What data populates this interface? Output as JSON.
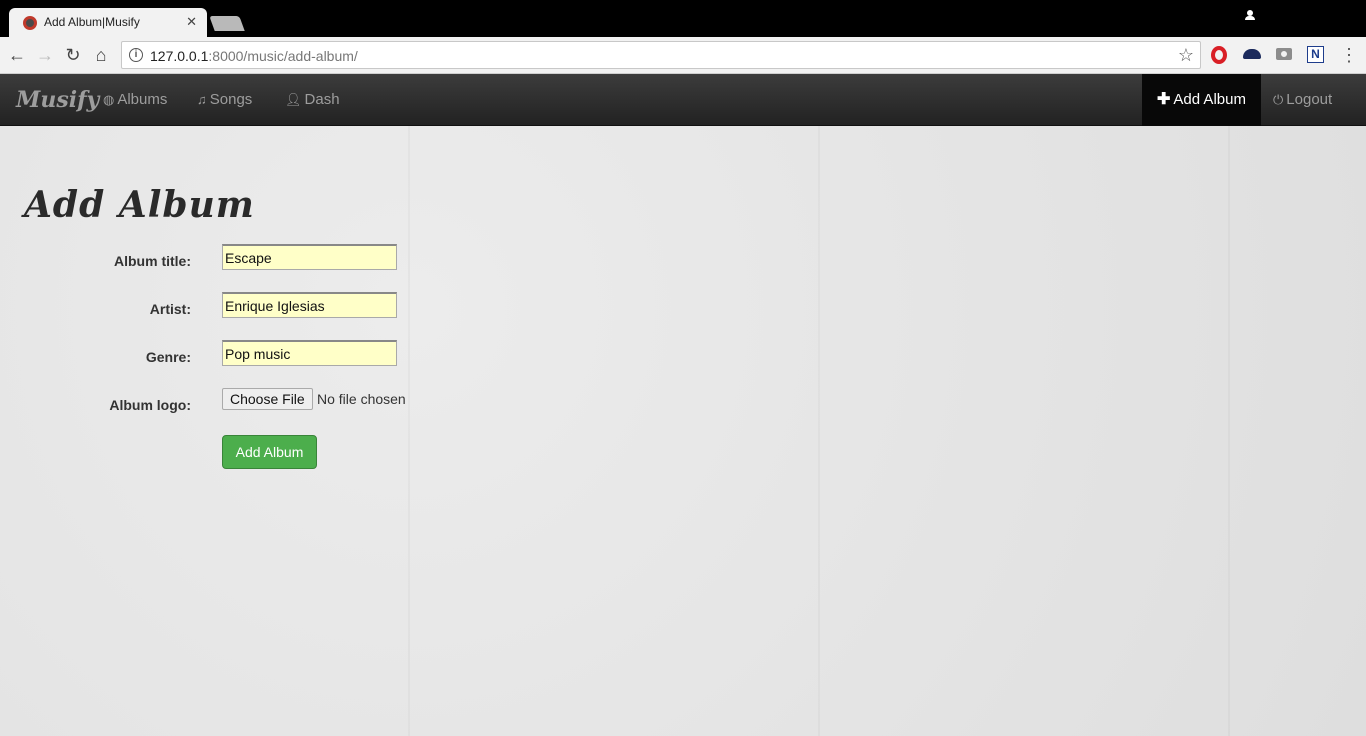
{
  "browser": {
    "tab_title": "Add Album|Musify",
    "url_host": "127.0.0.1",
    "url_rest": ":8000/music/add-album/"
  },
  "navbar": {
    "brand": "Musify",
    "items": [
      {
        "label": "Albums",
        "icon": "globe-icon"
      },
      {
        "label": "Songs",
        "icon": "music-note-icon"
      },
      {
        "label": "Dash",
        "icon": "user-icon"
      }
    ],
    "add_album": "Add Album",
    "logout": "Logout"
  },
  "form": {
    "heading": "Add Album",
    "fields": [
      {
        "label": "Album title:",
        "value": "Escape"
      },
      {
        "label": "Artist:",
        "value": "Enrique Iglesias"
      },
      {
        "label": "Genre:",
        "value": "Pop music"
      }
    ],
    "logo_label": "Album logo:",
    "file_button": "Choose File",
    "file_status": "No file chosen",
    "submit": "Add Album"
  },
  "colors": {
    "submit": "#4cae4c",
    "input_bg": "#ffffc8",
    "navbar": "#222222"
  }
}
